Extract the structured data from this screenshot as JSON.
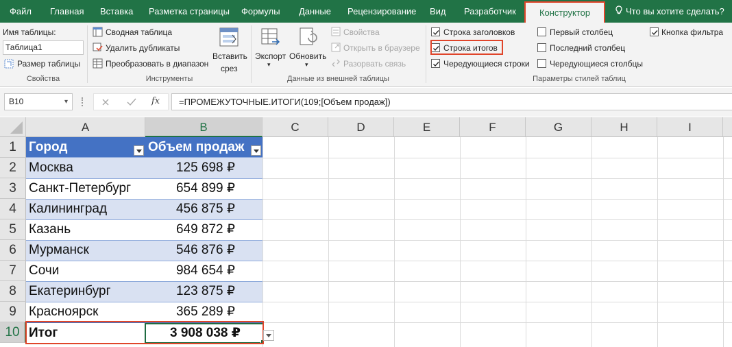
{
  "menu": {
    "tabs": [
      "Файл",
      "Главная",
      "Вставка",
      "Разметка страницы",
      "Формулы",
      "Данные",
      "Рецензирование",
      "Вид",
      "Разработчик",
      "Конструктор"
    ],
    "active_tab": "Конструктор",
    "tell_me": "Что вы хотите сделать?"
  },
  "ribbon": {
    "properties": {
      "name_label": "Имя таблицы:",
      "name_value": "Таблица1",
      "resize": "Размер таблицы",
      "group": "Свойства"
    },
    "tools": {
      "pivot": "Сводная таблица",
      "remove_dups": "Удалить дубликаты",
      "convert": "Преобразовать в диапазон",
      "slicer_line1": "Вставить",
      "slicer_line2": "срез",
      "group": "Инструменты"
    },
    "external": {
      "export": "Экспорт",
      "refresh": "Обновить",
      "properties": "Свойства",
      "open_browser": "Открыть в браузере",
      "unlink": "Разорвать связь",
      "group": "Данные из внешней таблицы"
    },
    "style_options": {
      "header_row": "Строка заголовков",
      "total_row": "Строка итогов",
      "banded_rows": "Чередующиеся строки",
      "first_col": "Первый столбец",
      "last_col": "Последний столбец",
      "banded_cols": "Чередующиеся столбцы",
      "filter_button": "Кнопка фильтра",
      "group": "Параметры стилей таблиц",
      "checked": {
        "header_row": true,
        "total_row": true,
        "banded_rows": true,
        "first_col": false,
        "last_col": false,
        "banded_cols": false,
        "filter_button": true
      }
    }
  },
  "formula_bar": {
    "cell_ref": "B10",
    "formula": "=ПРОМЕЖУТОЧНЫЕ.ИТОГИ(109;[Объем продаж])",
    "fx": "fx"
  },
  "sheet": {
    "columns": [
      "A",
      "B",
      "C",
      "D",
      "E",
      "F",
      "G",
      "H",
      "I"
    ],
    "rows": [
      "1",
      "2",
      "3",
      "4",
      "5",
      "6",
      "7",
      "8",
      "9",
      "10"
    ],
    "header": [
      "Город",
      "Объем продаж"
    ],
    "data": [
      [
        "Москва",
        "125 698 ₽"
      ],
      [
        "Санкт-Петербург",
        "654 899 ₽"
      ],
      [
        "Калининград",
        "456 875 ₽"
      ],
      [
        "Казань",
        "649 872 ₽"
      ],
      [
        "Мурманск",
        "546 876 ₽"
      ],
      [
        "Сочи",
        "984 654 ₽"
      ],
      [
        "Екатеринбург",
        "123 875 ₽"
      ],
      [
        "Красноярск",
        "365 289 ₽"
      ]
    ],
    "total": [
      "Итог",
      "3 908 038 ₽"
    ]
  },
  "colors": {
    "accent": "#217346",
    "highlight": "#e0452a",
    "table_header": "#4472c4",
    "band": "#d9e1f2"
  }
}
